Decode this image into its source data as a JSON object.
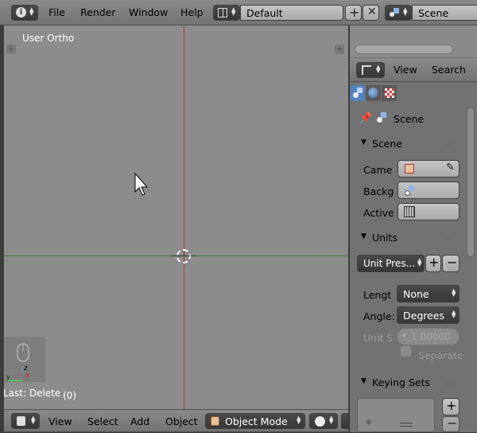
{
  "top_menu": [
    "File",
    "Render",
    "Window",
    "Help"
  ],
  "layout_name": "Default",
  "scene_name": "Scene",
  "viewport": {
    "label": "User Ortho",
    "last_op": "Last: Delete",
    "count": "(0)"
  },
  "bottom_menu": [
    "View",
    "Select",
    "Add",
    "Object"
  ],
  "mode": "Object Mode",
  "right_header": {
    "view": "View",
    "search": "Search"
  },
  "props": {
    "breadcrumb": "Scene",
    "scene_panel": {
      "title": "Scene",
      "camera": "Came",
      "background": "Backg",
      "active": "Active"
    },
    "units_panel": {
      "title": "Units",
      "preset": "Unit Pres...",
      "length_label": "Lengt",
      "length_value": "None",
      "angle_label": "Angle:",
      "angle_value": "Degrees",
      "scale_label": "Unit S",
      "scale_value": "1.00000",
      "separate": "Separate"
    },
    "keying_panel": {
      "title": "Keying Sets"
    }
  }
}
